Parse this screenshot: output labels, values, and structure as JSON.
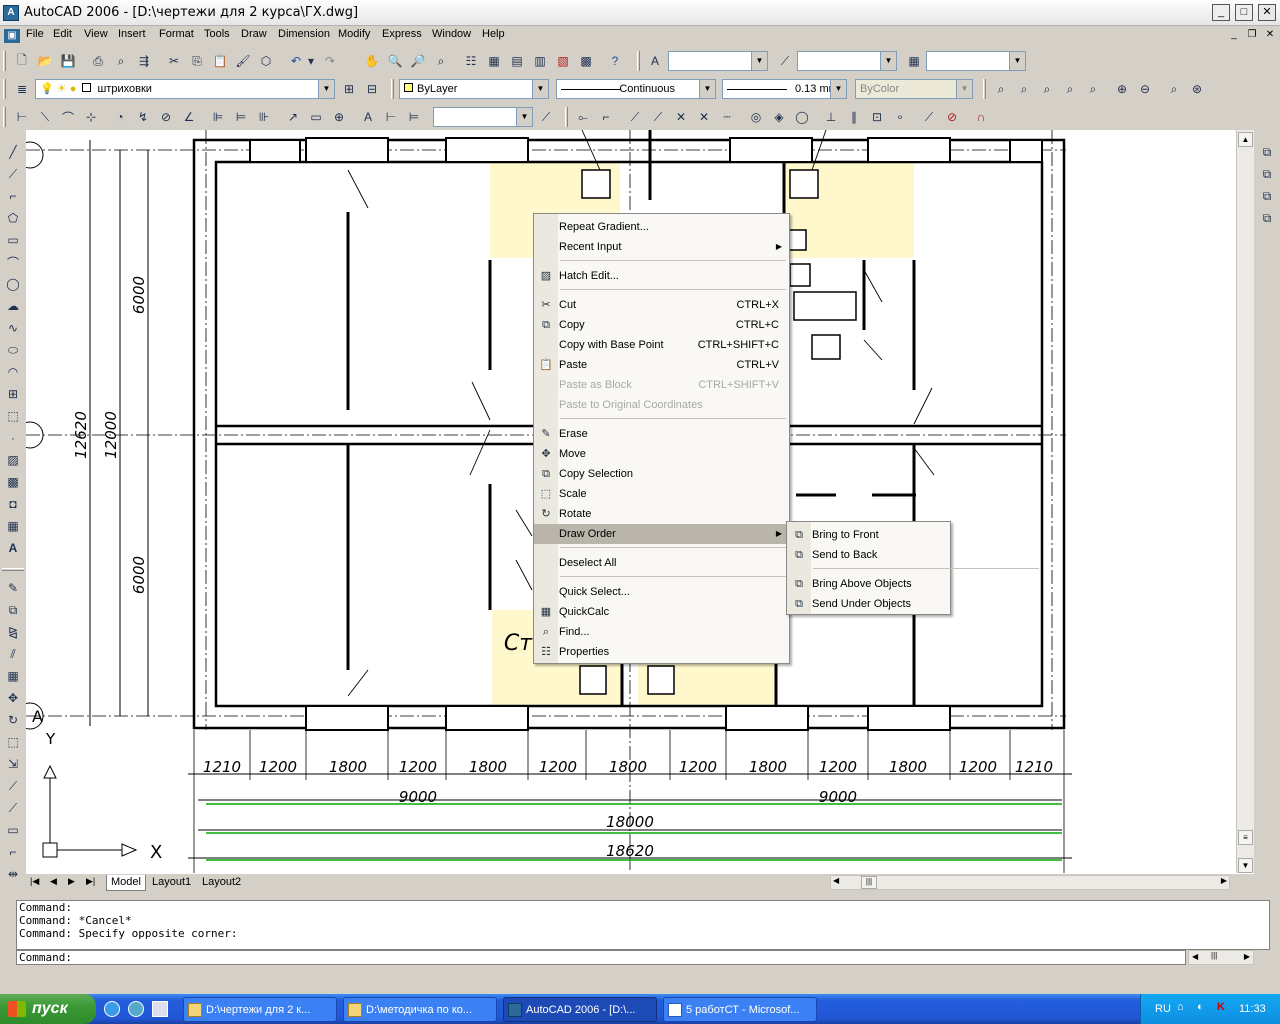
{
  "window": {
    "title": "AutoCAD 2006 - [D:\\чертежи для 2 курса\\ГХ.dwg]",
    "min": "_",
    "max": "□",
    "close": "✕"
  },
  "menubar": [
    "File",
    "Edit",
    "View",
    "Insert",
    "Format",
    "Tools",
    "Draw",
    "Dimension",
    "Modify",
    "Express",
    "Window",
    "Help"
  ],
  "layers": {
    "current_layer": "штриховки",
    "color": "ByLayer",
    "linetype": "Continuous",
    "lineweight": "0.13 mm",
    "plotstyle": "ByColor"
  },
  "drawing": {
    "dims_top_row": [
      "1210",
      "1200",
      "1800",
      "1200",
      "1800",
      "1200",
      "1800",
      "1200",
      "1800",
      "1200",
      "1800",
      "1200",
      "1210"
    ],
    "dims_mid": [
      "9000",
      "9000"
    ],
    "dim_total_inner": "18000",
    "dim_total_outer": "18620",
    "dims_left": [
      "6000",
      "6000",
      "12000",
      "12620"
    ],
    "room_label": "Ст",
    "ucs_x": "X",
    "ucs_y": "Y",
    "axis_a": "A"
  },
  "context_menu": {
    "items": [
      {
        "label": "Repeat Gradient...",
        "shortcut": "",
        "icon": ""
      },
      {
        "label": "Recent Input",
        "shortcut": "",
        "icon": "",
        "submenu": true
      },
      {
        "label": "Hatch Edit...",
        "shortcut": "",
        "icon": "hatch-edit-icon"
      },
      {
        "label": "Cut",
        "shortcut": "CTRL+X",
        "icon": "scissors-icon"
      },
      {
        "label": "Copy",
        "shortcut": "CTRL+C",
        "icon": "copy-icon"
      },
      {
        "label": "Copy with Base Point",
        "shortcut": "CTRL+SHIFT+C",
        "icon": ""
      },
      {
        "label": "Paste",
        "shortcut": "CTRL+V",
        "icon": "paste-icon"
      },
      {
        "label": "Paste as Block",
        "shortcut": "CTRL+SHIFT+V",
        "icon": "",
        "disabled": true
      },
      {
        "label": "Paste to Original Coordinates",
        "shortcut": "",
        "icon": "",
        "disabled": true
      },
      {
        "label": "Erase",
        "shortcut": "",
        "icon": "eraser-icon"
      },
      {
        "label": "Move",
        "shortcut": "",
        "icon": "move-icon"
      },
      {
        "label": "Copy Selection",
        "shortcut": "",
        "icon": "copy-selection-icon"
      },
      {
        "label": "Scale",
        "shortcut": "",
        "icon": "scale-icon"
      },
      {
        "label": "Rotate",
        "shortcut": "",
        "icon": "rotate-icon"
      },
      {
        "label": "Draw Order",
        "shortcut": "",
        "icon": "",
        "submenu": true,
        "highlighted": true
      },
      {
        "label": "Deselect All",
        "shortcut": "",
        "icon": ""
      },
      {
        "label": "Quick Select...",
        "shortcut": "",
        "icon": ""
      },
      {
        "label": "QuickCalc",
        "shortcut": "",
        "icon": "calculator-icon"
      },
      {
        "label": "Find...",
        "shortcut": "",
        "icon": "find-icon"
      },
      {
        "label": "Properties",
        "shortcut": "",
        "icon": "properties-icon"
      }
    ],
    "draw_order_submenu": [
      "Bring to Front",
      "Send to Back",
      "Bring Above Objects",
      "Send Under Objects"
    ]
  },
  "layout_tabs": [
    "Model",
    "Layout1",
    "Layout2"
  ],
  "command_history": [
    "Command:",
    "Command: *Cancel*",
    "Command: Specify opposite corner:"
  ],
  "command_prompt": "Command:",
  "taskbar": {
    "start": "пуск",
    "tasks": [
      "D:\\чертежи для 2 к...",
      "D:\\методичка по ко...",
      "AutoCAD 2006 - [D:\\...",
      "5 работСТ - Microsof..."
    ],
    "lang": "RU",
    "clock": "11:33"
  }
}
